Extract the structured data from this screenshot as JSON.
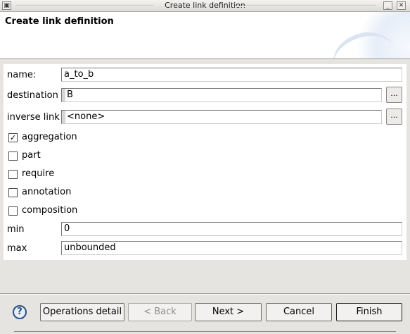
{
  "window": {
    "title": "Create link definition",
    "menu_icon": "window-menu-icon",
    "minimize_icon": "minimize-icon",
    "close_icon": "close-icon"
  },
  "banner": {
    "heading": "Create link definition"
  },
  "form": {
    "name_label": "name:",
    "name_value": "a_to_b",
    "destination_label": "destination",
    "destination_value": "B",
    "inverse_label": "inverse link",
    "inverse_value": "<none>",
    "browse_label": "...",
    "checkboxes": [
      {
        "label": "aggregation",
        "checked": true
      },
      {
        "label": "part",
        "checked": false
      },
      {
        "label": "require",
        "checked": false
      },
      {
        "label": "annotation",
        "checked": false
      },
      {
        "label": "composition",
        "checked": false
      }
    ],
    "min_label": "min",
    "min_value": "0",
    "max_label": "max",
    "max_value": "unbounded"
  },
  "footer": {
    "help_icon": "help-icon",
    "operations_label": "Operations detail",
    "back_label": "< Back",
    "next_label": "Next >",
    "cancel_label": "Cancel",
    "finish_label": "Finish"
  }
}
